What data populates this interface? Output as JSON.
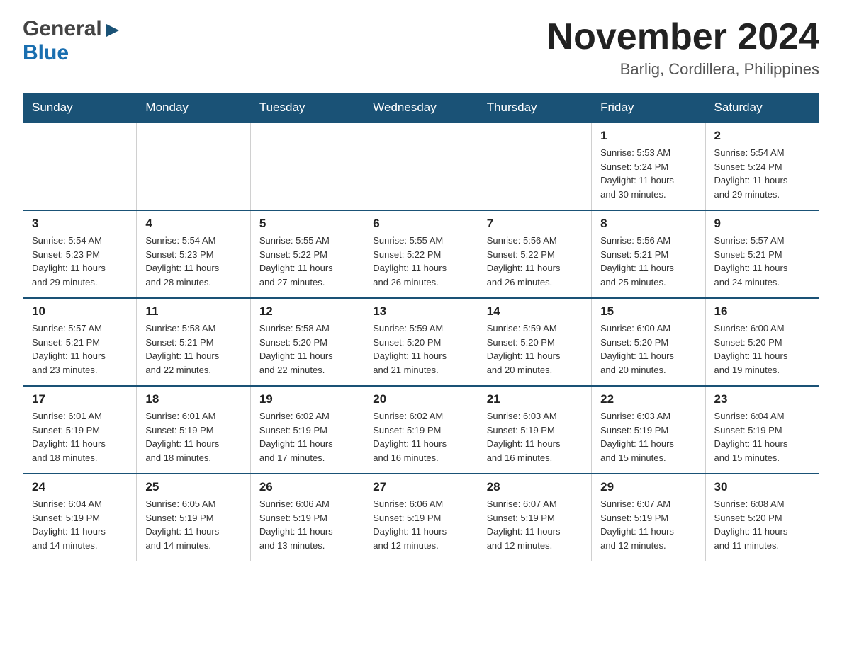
{
  "header": {
    "logo_general": "General",
    "logo_blue": "Blue",
    "month_title": "November 2024",
    "location": "Barlig, Cordillera, Philippines"
  },
  "weekdays": [
    "Sunday",
    "Monday",
    "Tuesday",
    "Wednesday",
    "Thursday",
    "Friday",
    "Saturday"
  ],
  "weeks": [
    [
      {
        "day": "",
        "info": ""
      },
      {
        "day": "",
        "info": ""
      },
      {
        "day": "",
        "info": ""
      },
      {
        "day": "",
        "info": ""
      },
      {
        "day": "",
        "info": ""
      },
      {
        "day": "1",
        "info": "Sunrise: 5:53 AM\nSunset: 5:24 PM\nDaylight: 11 hours\nand 30 minutes."
      },
      {
        "day": "2",
        "info": "Sunrise: 5:54 AM\nSunset: 5:24 PM\nDaylight: 11 hours\nand 29 minutes."
      }
    ],
    [
      {
        "day": "3",
        "info": "Sunrise: 5:54 AM\nSunset: 5:23 PM\nDaylight: 11 hours\nand 29 minutes."
      },
      {
        "day": "4",
        "info": "Sunrise: 5:54 AM\nSunset: 5:23 PM\nDaylight: 11 hours\nand 28 minutes."
      },
      {
        "day": "5",
        "info": "Sunrise: 5:55 AM\nSunset: 5:22 PM\nDaylight: 11 hours\nand 27 minutes."
      },
      {
        "day": "6",
        "info": "Sunrise: 5:55 AM\nSunset: 5:22 PM\nDaylight: 11 hours\nand 26 minutes."
      },
      {
        "day": "7",
        "info": "Sunrise: 5:56 AM\nSunset: 5:22 PM\nDaylight: 11 hours\nand 26 minutes."
      },
      {
        "day": "8",
        "info": "Sunrise: 5:56 AM\nSunset: 5:21 PM\nDaylight: 11 hours\nand 25 minutes."
      },
      {
        "day": "9",
        "info": "Sunrise: 5:57 AM\nSunset: 5:21 PM\nDaylight: 11 hours\nand 24 minutes."
      }
    ],
    [
      {
        "day": "10",
        "info": "Sunrise: 5:57 AM\nSunset: 5:21 PM\nDaylight: 11 hours\nand 23 minutes."
      },
      {
        "day": "11",
        "info": "Sunrise: 5:58 AM\nSunset: 5:21 PM\nDaylight: 11 hours\nand 22 minutes."
      },
      {
        "day": "12",
        "info": "Sunrise: 5:58 AM\nSunset: 5:20 PM\nDaylight: 11 hours\nand 22 minutes."
      },
      {
        "day": "13",
        "info": "Sunrise: 5:59 AM\nSunset: 5:20 PM\nDaylight: 11 hours\nand 21 minutes."
      },
      {
        "day": "14",
        "info": "Sunrise: 5:59 AM\nSunset: 5:20 PM\nDaylight: 11 hours\nand 20 minutes."
      },
      {
        "day": "15",
        "info": "Sunrise: 6:00 AM\nSunset: 5:20 PM\nDaylight: 11 hours\nand 20 minutes."
      },
      {
        "day": "16",
        "info": "Sunrise: 6:00 AM\nSunset: 5:20 PM\nDaylight: 11 hours\nand 19 minutes."
      }
    ],
    [
      {
        "day": "17",
        "info": "Sunrise: 6:01 AM\nSunset: 5:19 PM\nDaylight: 11 hours\nand 18 minutes."
      },
      {
        "day": "18",
        "info": "Sunrise: 6:01 AM\nSunset: 5:19 PM\nDaylight: 11 hours\nand 18 minutes."
      },
      {
        "day": "19",
        "info": "Sunrise: 6:02 AM\nSunset: 5:19 PM\nDaylight: 11 hours\nand 17 minutes."
      },
      {
        "day": "20",
        "info": "Sunrise: 6:02 AM\nSunset: 5:19 PM\nDaylight: 11 hours\nand 16 minutes."
      },
      {
        "day": "21",
        "info": "Sunrise: 6:03 AM\nSunset: 5:19 PM\nDaylight: 11 hours\nand 16 minutes."
      },
      {
        "day": "22",
        "info": "Sunrise: 6:03 AM\nSunset: 5:19 PM\nDaylight: 11 hours\nand 15 minutes."
      },
      {
        "day": "23",
        "info": "Sunrise: 6:04 AM\nSunset: 5:19 PM\nDaylight: 11 hours\nand 15 minutes."
      }
    ],
    [
      {
        "day": "24",
        "info": "Sunrise: 6:04 AM\nSunset: 5:19 PM\nDaylight: 11 hours\nand 14 minutes."
      },
      {
        "day": "25",
        "info": "Sunrise: 6:05 AM\nSunset: 5:19 PM\nDaylight: 11 hours\nand 14 minutes."
      },
      {
        "day": "26",
        "info": "Sunrise: 6:06 AM\nSunset: 5:19 PM\nDaylight: 11 hours\nand 13 minutes."
      },
      {
        "day": "27",
        "info": "Sunrise: 6:06 AM\nSunset: 5:19 PM\nDaylight: 11 hours\nand 12 minutes."
      },
      {
        "day": "28",
        "info": "Sunrise: 6:07 AM\nSunset: 5:19 PM\nDaylight: 11 hours\nand 12 minutes."
      },
      {
        "day": "29",
        "info": "Sunrise: 6:07 AM\nSunset: 5:19 PM\nDaylight: 11 hours\nand 12 minutes."
      },
      {
        "day": "30",
        "info": "Sunrise: 6:08 AM\nSunset: 5:20 PM\nDaylight: 11 hours\nand 11 minutes."
      }
    ]
  ]
}
